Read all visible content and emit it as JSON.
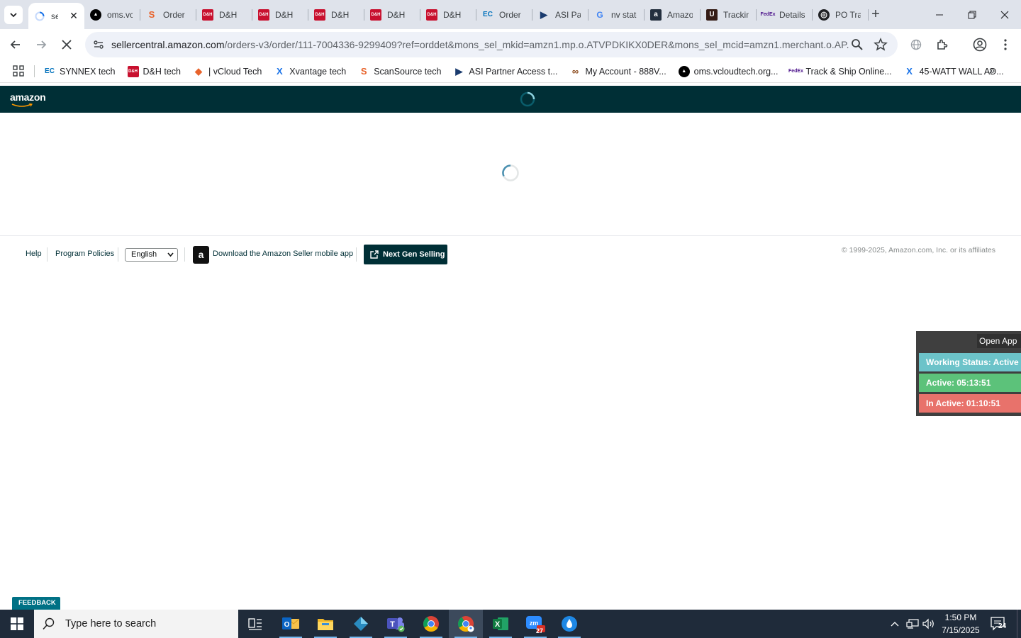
{
  "browser": {
    "tabs": [
      {
        "title": "sellercentral",
        "favicon": "seller-spinner-icon",
        "color": "#1a73e8",
        "active": true
      },
      {
        "title": "oms.vcloudtech",
        "favicon": "oms-icon",
        "color": "#000000"
      },
      {
        "title": "Order",
        "favicon": "scansource-icon",
        "color": "#e8632b"
      },
      {
        "title": "D&H",
        "favicon": "dh-icon",
        "color": "#c8102e"
      },
      {
        "title": "D&H",
        "favicon": "dh-icon",
        "color": "#c8102e"
      },
      {
        "title": "D&H",
        "favicon": "dh-icon",
        "color": "#c8102e"
      },
      {
        "title": "D&H",
        "favicon": "dh-icon",
        "color": "#c8102e"
      },
      {
        "title": "D&H",
        "favicon": "dh-icon",
        "color": "#c8102e"
      },
      {
        "title": "Order",
        "favicon": "synnex-ec-icon",
        "color": "#0071bc"
      },
      {
        "title": "ASI Partner",
        "favicon": "asi-arrow-icon",
        "color": "#1a3b6e"
      },
      {
        "title": "nv state",
        "favicon": "google-icon",
        "color": "#4285f4"
      },
      {
        "title": "Amazon",
        "favicon": "amazon-a-icon",
        "color": "#232f3e"
      },
      {
        "title": "Tracking",
        "favicon": "ups-icon",
        "color": "#351c15"
      },
      {
        "title": "Details",
        "favicon": "fedex-icon",
        "color": "#4d148c"
      },
      {
        "title": "PO Track",
        "favicon": "po-track-icon",
        "color": "#202124"
      }
    ],
    "address": {
      "domain": "sellercentral.amazon.com",
      "path": "/orders-v3/order/111-7004336-9299409?ref=orddet&mons_sel_mkid=amzn1.mp.o.ATVPDKIKX0DER&mons_sel_mcid=amzn1.merchant.o.AP..."
    },
    "bookmarks": [
      {
        "label": "SYNNEX tech",
        "favicon": "synnex-ec-icon",
        "color": "#0071bc"
      },
      {
        "label": "D&H tech",
        "favicon": "dh-icon",
        "color": "#c8102e"
      },
      {
        "label": "| vCloud Tech",
        "favicon": "vcloud-icon",
        "color": "#e8632b"
      },
      {
        "label": "Xvantage tech",
        "favicon": "xvantage-icon",
        "color": "#1a73e8"
      },
      {
        "label": "ScanSource tech",
        "favicon": "scansource-icon",
        "color": "#e8632b"
      },
      {
        "label": "ASI Partner Access t...",
        "favicon": "asi-arrow-icon",
        "color": "#1a3b6e"
      },
      {
        "label": "My Account - 888V...",
        "favicon": "my-account-icon",
        "color": "#8b4a1c"
      },
      {
        "label": "oms.vcloudtech.org...",
        "favicon": "oms-icon",
        "color": "#000000"
      },
      {
        "label": "Track & Ship Online...",
        "favicon": "fedex-icon",
        "color": "#4d148c"
      },
      {
        "label": "45-WATT WALL AD...",
        "favicon": "xvantage-icon",
        "color": "#1a73e8"
      }
    ]
  },
  "amazon": {
    "logo": "amazon",
    "footer": {
      "help": "Help",
      "policies": "Program Policies",
      "language": "English",
      "app_download": "Download the Amazon Seller mobile app",
      "app_icon_letter": "a",
      "next_gen": "Next Gen Selling",
      "copyright": "© 1999-2025, Amazon.com, Inc. or its affiliates"
    },
    "feedback": "FEEDBACK",
    "feedback_close": "×"
  },
  "work_widget": {
    "open_app": "Open App",
    "status": "Working Status: Active",
    "active": "Active: 05:13:51",
    "inactive": "In Active: 01:10:51",
    "colors": {
      "status": "#6cc3c9",
      "active": "#5cc27a",
      "inactive": "#e8726b"
    }
  },
  "taskbar": {
    "search_placeholder": "Type here to search",
    "apps": [
      "task-view-icon",
      "outlook-icon",
      "file-explorer-icon",
      "app-diamond-icon",
      "teams-icon",
      "chrome-icon",
      "chrome-profile-icon",
      "excel-icon",
      "zoom-icon",
      "app-drop-icon"
    ],
    "zoom_badge": "27",
    "time": "1:50 PM",
    "date": "7/15/2025",
    "notifications": "24"
  }
}
